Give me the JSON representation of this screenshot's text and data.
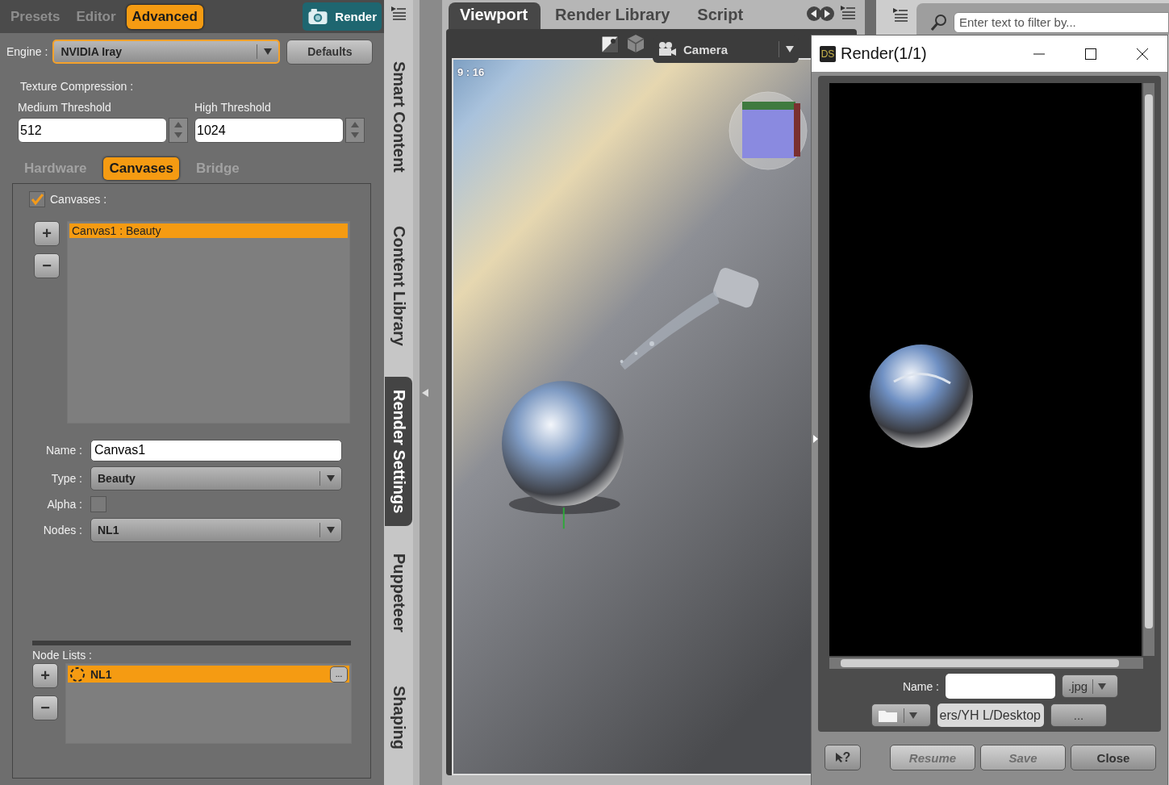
{
  "left_panel": {
    "tabs": [
      {
        "label": "Presets",
        "selected": false
      },
      {
        "label": "Editor",
        "selected": false
      },
      {
        "label": "Advanced",
        "selected": true
      }
    ],
    "render_button": "Render",
    "engine": {
      "label": "Engine :",
      "value": "NVIDIA Iray"
    },
    "defaults_button": "Defaults",
    "texture_compression": {
      "title": "Texture Compression :",
      "fields": [
        {
          "label": "Medium Threshold",
          "value": "512"
        },
        {
          "label": "High Threshold",
          "value": "1024"
        }
      ]
    },
    "sub_tabs": [
      {
        "label": "Hardware",
        "selected": false
      },
      {
        "label": "Canvases",
        "selected": true
      },
      {
        "label": "Bridge",
        "selected": false
      }
    ],
    "canvases": {
      "label": "Canvases :",
      "checked": true,
      "add_button": "+",
      "remove_button": "−",
      "items": [
        {
          "label": "Canvas1 : Beauty",
          "selected": true
        }
      ],
      "name": {
        "label": "Name :",
        "value": "Canvas1"
      },
      "type": {
        "label": "Type :",
        "value": "Beauty"
      },
      "alpha": {
        "label": "Alpha :",
        "checked": false
      },
      "nodes": {
        "label": "Nodes :",
        "value": "NL1"
      }
    },
    "node_lists": {
      "title": "Node Lists :",
      "add_button": "+",
      "remove_button": "−",
      "items": [
        {
          "label": "NL1",
          "selected": true,
          "more_button": "..."
        }
      ]
    }
  },
  "side_tabs": [
    {
      "label": "Smart Content",
      "selected": false
    },
    {
      "label": "Content Library",
      "selected": false
    },
    {
      "label": "Render Settings",
      "selected": true
    },
    {
      "label": "Puppeteer",
      "selected": false
    },
    {
      "label": "Shaping",
      "selected": false
    }
  ],
  "viewport_pane": {
    "tabs": [
      {
        "label": "Viewport",
        "selected": true
      },
      {
        "label": "Render Library",
        "selected": false
      },
      {
        "label": "Script",
        "selected": false
      }
    ],
    "camera": "Camera",
    "aspect": "9 : 16"
  },
  "filter_field": {
    "placeholder": "Enter text to filter by..."
  },
  "render_window": {
    "app_badge": "DS",
    "title": "Render(1/1)",
    "name_label": "Name :",
    "format": ".jpg",
    "path": "ers/YH L/Desktop",
    "browse_button": "...",
    "help_button": "?",
    "buttons": [
      {
        "label": "Resume",
        "disabled": true
      },
      {
        "label": "Save",
        "disabled": true
      },
      {
        "label": "Close",
        "disabled": false
      }
    ]
  }
}
